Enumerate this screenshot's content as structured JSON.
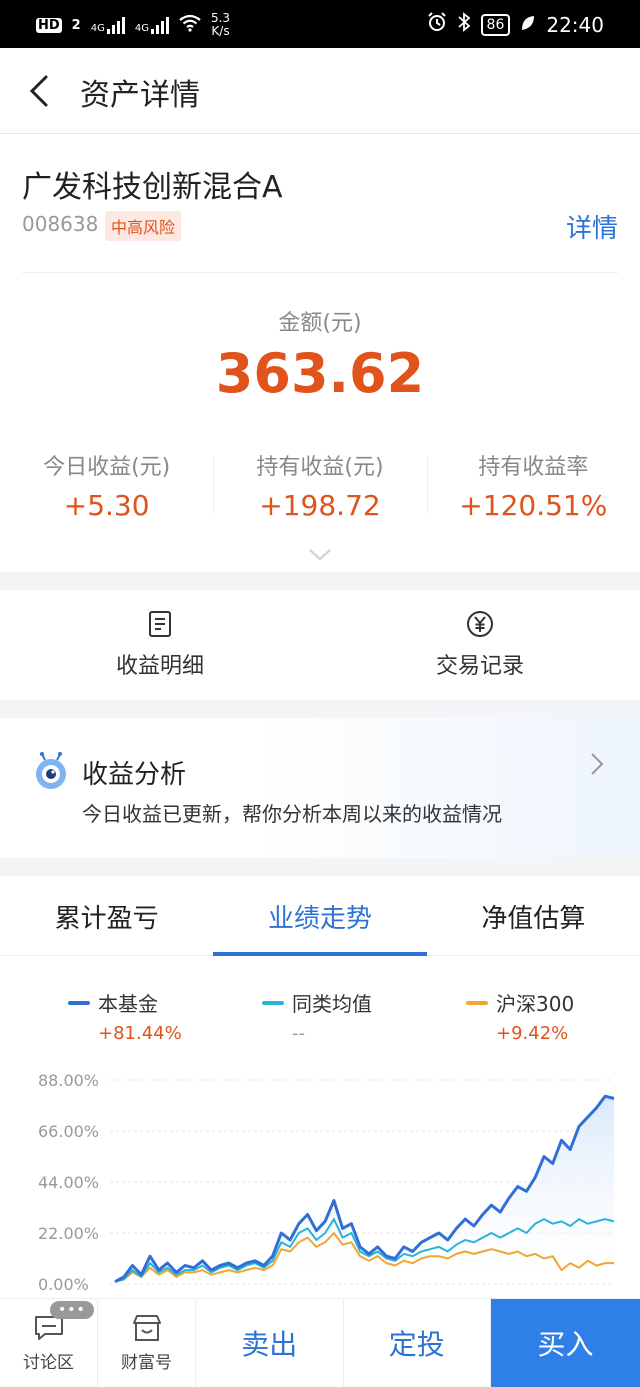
{
  "status_bar": {
    "network_label": "HD",
    "sim2": "2",
    "signal1": "4G",
    "signal2": "4G",
    "speed": "5.3",
    "speed_unit": "K/s",
    "battery": "86",
    "time": "22:40"
  },
  "header": {
    "title": "资产详情"
  },
  "fund": {
    "name": "广发科技创新混合A",
    "code": "008638",
    "risk": "中高风险",
    "detail_link": "详情"
  },
  "amount": {
    "label": "金额(元)",
    "value": "363.62"
  },
  "stats": [
    {
      "label": "今日收益(元)",
      "value": "+5.30"
    },
    {
      "label": "持有收益(元)",
      "value": "+198.72"
    },
    {
      "label": "持有收益率",
      "value": "+120.51%"
    }
  ],
  "entries": [
    {
      "label": "收益明细",
      "icon": "document-icon"
    },
    {
      "label": "交易记录",
      "icon": "yen-circle-icon"
    }
  ],
  "analysis": {
    "title": "收益分析",
    "description": "今日收益已更新，帮你分析本周以来的收益情况"
  },
  "tabs": [
    {
      "label": "累计盈亏",
      "active": false
    },
    {
      "label": "业绩走势",
      "active": true
    },
    {
      "label": "净值估算",
      "active": false
    }
  ],
  "legend": [
    {
      "name": "本基金",
      "value": "+81.44%",
      "color": "#2f6fd6",
      "value_color": "#e0531b"
    },
    {
      "name": "同类均值",
      "value": "--",
      "color": "#29b3d9",
      "value_color": "#999999"
    },
    {
      "name": "沪深300",
      "value": "+9.42%",
      "color": "#f0a630",
      "value_color": "#e0531b"
    }
  ],
  "chart_data": {
    "type": "line",
    "y_ticks": [
      "88.00%",
      "66.00%",
      "44.00%",
      "22.00%",
      "0.00%"
    ],
    "ylim": [
      0,
      88
    ],
    "grid": true,
    "series": [
      {
        "name": "本基金",
        "color": "#2f6fd6",
        "values": [
          1,
          3,
          8,
          4,
          12,
          6,
          9,
          5,
          8,
          7,
          10,
          6,
          8,
          9,
          7,
          9,
          10,
          8,
          12,
          22,
          19,
          26,
          30,
          23,
          27,
          36,
          24,
          26,
          16,
          13,
          16,
          12,
          11,
          16,
          14,
          18,
          20,
          22,
          19,
          24,
          28,
          25,
          30,
          34,
          31,
          37,
          42,
          40,
          46,
          55,
          52,
          62,
          58,
          68,
          72,
          76,
          81,
          80
        ]
      },
      {
        "name": "同类均值",
        "color": "#29b3d9",
        "values": [
          1,
          2,
          6,
          3,
          9,
          5,
          7,
          4,
          6,
          6,
          8,
          5,
          7,
          8,
          6,
          8,
          9,
          7,
          10,
          18,
          16,
          22,
          24,
          19,
          22,
          28,
          20,
          22,
          14,
          12,
          14,
          11,
          10,
          13,
          12,
          14,
          15,
          16,
          14,
          17,
          19,
          18,
          20,
          22,
          20,
          22,
          24,
          22,
          26,
          28,
          26,
          27,
          25,
          28,
          26,
          27,
          28,
          27
        ]
      },
      {
        "name": "沪深300",
        "color": "#f0a630",
        "values": [
          1,
          2,
          5,
          3,
          7,
          4,
          6,
          3,
          5,
          5,
          6,
          4,
          5,
          6,
          5,
          6,
          7,
          6,
          8,
          15,
          14,
          18,
          20,
          16,
          18,
          22,
          17,
          18,
          12,
          10,
          12,
          9,
          8,
          10,
          9,
          11,
          12,
          12,
          11,
          13,
          14,
          13,
          14,
          15,
          14,
          13,
          14,
          12,
          13,
          11,
          12,
          6,
          9,
          7,
          10,
          8,
          9,
          9
        ]
      }
    ]
  },
  "bottom_bar": {
    "discussion_label": "讨论区",
    "discussion_badge": "•••",
    "wealth_label": "财富号",
    "sell_label": "卖出",
    "regular_label": "定投",
    "buy_label": "买入"
  }
}
